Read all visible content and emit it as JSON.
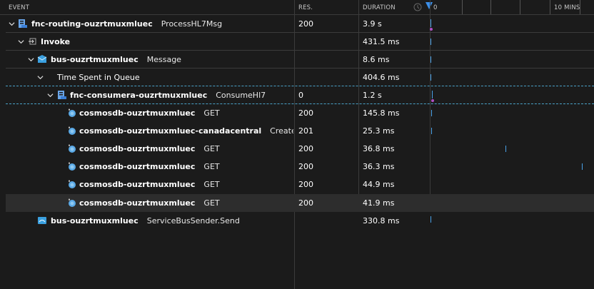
{
  "header": {
    "event": "EVENT",
    "res": "RES.",
    "duration": "DURATION",
    "timeline_start": "0",
    "timeline_end": "10 MINS"
  },
  "rows": [
    {
      "name": "fnc-routing-ouzrtmuxmluec",
      "op": "ProcessHL7Msg",
      "res": "200",
      "duration": "3.9 s",
      "icon": "function-app-icon",
      "expandable": true
    },
    {
      "name": "Invoke",
      "op": "",
      "res": "",
      "duration": "431.5 ms",
      "icon": "invoke-icon",
      "expandable": true
    },
    {
      "name": "bus-ouzrtmuxmluec",
      "op": "Message",
      "res": "",
      "duration": "8.6 ms",
      "icon": "service-bus-icon",
      "expandable": true
    },
    {
      "name": "Time Spent in Queue",
      "op": "",
      "res": "",
      "duration": "404.6 ms",
      "icon": "",
      "expandable": true
    },
    {
      "name": "fnc-consumera-ouzrtmuxmluec",
      "op": "ConsumeHl7",
      "res": "0",
      "duration": "1.2 s",
      "icon": "function-app-icon",
      "expandable": true
    },
    {
      "name": "cosmosdb-ouzrtmuxmluec",
      "op": "GET",
      "res": "200",
      "duration": "145.8 ms",
      "icon": "cosmosdb-icon",
      "expandable": false
    },
    {
      "name": "cosmosdb-ouzrtmuxmluec-canadacentral",
      "op": "Create documen",
      "res": "201",
      "duration": "25.3 ms",
      "icon": "cosmosdb-icon",
      "expandable": false
    },
    {
      "name": "cosmosdb-ouzrtmuxmluec",
      "op": "GET",
      "res": "200",
      "duration": "36.8 ms",
      "icon": "cosmosdb-icon",
      "expandable": false
    },
    {
      "name": "cosmosdb-ouzrtmuxmluec",
      "op": "GET",
      "res": "200",
      "duration": "36.3 ms",
      "icon": "cosmosdb-icon",
      "expandable": false
    },
    {
      "name": "cosmosdb-ouzrtmuxmluec",
      "op": "GET",
      "res": "200",
      "duration": "44.9 ms",
      "icon": "cosmosdb-icon",
      "expandable": false
    },
    {
      "name": "cosmosdb-ouzrtmuxmluec",
      "op": "GET",
      "res": "200",
      "duration": "41.9 ms",
      "icon": "cosmosdb-icon",
      "expandable": false
    },
    {
      "name": "bus-ouzrtmuxmluec",
      "op": "ServiceBusSender.Send",
      "res": "",
      "duration": "330.8 ms",
      "icon": "service-bus-icon",
      "expandable": false
    }
  ]
}
